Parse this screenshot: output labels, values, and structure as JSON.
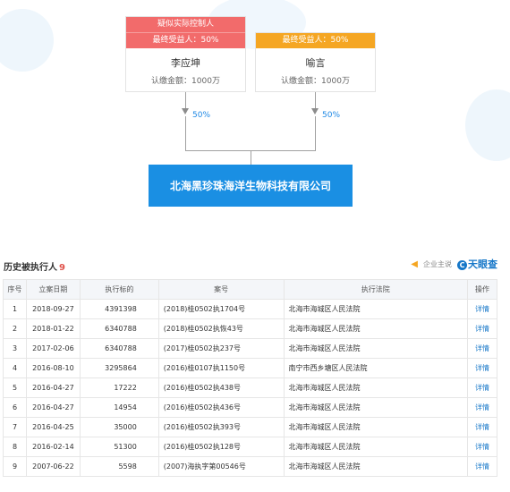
{
  "holders": [
    {
      "badge1": "疑似实际控制人",
      "badge2": "最终受益人：50%",
      "name": "李应坤",
      "amount": "认缴金额：1000万",
      "share": "50%"
    },
    {
      "badge2": "最终受益人：50%",
      "name": "喻言",
      "amount": "认缴金额：1000万",
      "share": "50%"
    }
  ],
  "company": "北海黑珍珠海洋生物科技有限公司",
  "section": {
    "title": "历史被执行人",
    "count": "9",
    "brand_label": "企业主说",
    "brand_logo": "天眼查"
  },
  "table": {
    "headers": [
      "序号",
      "立案日期",
      "执行标的",
      "案号",
      "执行法院",
      "操作"
    ],
    "rows": [
      [
        "1",
        "2018-09-27",
        "4391398",
        "(2018)桂0502执1704号",
        "北海市海城区人民法院",
        "详情"
      ],
      [
        "2",
        "2018-01-22",
        "6340788",
        "(2018)桂0502执恢43号",
        "北海市海城区人民法院",
        "详情"
      ],
      [
        "3",
        "2017-02-06",
        "6340788",
        "(2017)桂0502执237号",
        "北海市海城区人民法院",
        "详情"
      ],
      [
        "4",
        "2016-08-10",
        "3295864",
        "(2016)桂0107执1150号",
        "南宁市西乡塘区人民法院",
        "详情"
      ],
      [
        "5",
        "2016-04-27",
        "17222",
        "(2016)桂0502执438号",
        "北海市海城区人民法院",
        "详情"
      ],
      [
        "6",
        "2016-04-27",
        "14954",
        "(2016)桂0502执436号",
        "北海市海城区人民法院",
        "详情"
      ],
      [
        "7",
        "2016-04-25",
        "35000",
        "(2016)桂0502执393号",
        "北海市海城区人民法院",
        "详情"
      ],
      [
        "8",
        "2016-02-14",
        "51300",
        "(2016)桂0502执128号",
        "北海市海城区人民法院",
        "详情"
      ],
      [
        "9",
        "2007-06-22",
        "5598",
        "(2007)海执字第00546号",
        "北海市海城区人民法院",
        "详情"
      ]
    ]
  },
  "colors": {
    "controller_badge": "#f26b6b",
    "beneficiary_badge": "#f5a623",
    "company_box": "#1a8fe3",
    "link": "#1677c8",
    "count": "#e0524a"
  }
}
